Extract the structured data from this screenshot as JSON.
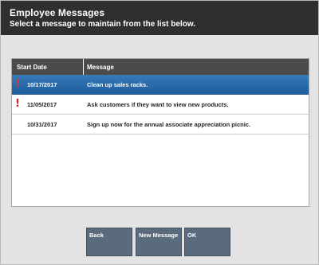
{
  "header": {
    "title": "Employee Messages",
    "subtitle": "Select a message to maintain from the list below."
  },
  "table": {
    "columns": [
      "Start Date",
      "Message"
    ],
    "rows": [
      {
        "alert": true,
        "date": "10/17/2017",
        "message": "Clean up sales racks.",
        "selected": true
      },
      {
        "alert": true,
        "date": "11/05/2017",
        "message": "Ask customers if they want to view new products.",
        "selected": false
      },
      {
        "alert": false,
        "date": "10/31/2017",
        "message": "Sign up now for the annual associate appreciation picnic.",
        "selected": false
      }
    ]
  },
  "icons": {
    "alert": "exclamation-icon"
  },
  "colors": {
    "header_bg": "#2f2f2f",
    "selected_row": "#2a6aaa",
    "alert": "#d42020",
    "button_bg": "#5a6b7d"
  },
  "buttons": {
    "back": "Back",
    "new_message": "New Message",
    "ok": "OK"
  }
}
